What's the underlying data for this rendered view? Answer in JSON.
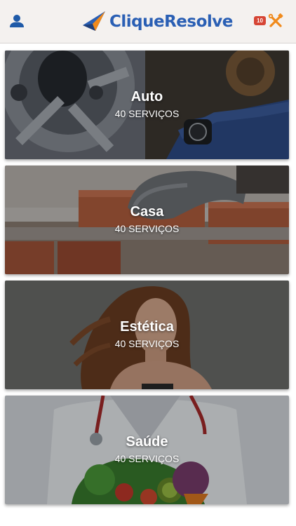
{
  "header": {
    "brand_name": "CliqueResolve",
    "notification_count": "10",
    "icons": {
      "user": "user-icon",
      "logo": "paper-plane-logo",
      "tools": "wrench-screwdriver-icon"
    },
    "colors": {
      "brand_blue": "#2a5fb4",
      "brand_dark": "#1e3f7a",
      "accent_orange": "#f08a1c",
      "badge_red": "#d64535",
      "header_bg": "#f4f1ef"
    }
  },
  "categories": [
    {
      "title": "Auto",
      "count": "40 SERVIÇOS"
    },
    {
      "title": "Casa",
      "count": "40 SERVIÇOS"
    },
    {
      "title": "Estética",
      "count": "40 SERVIÇOS"
    },
    {
      "title": "Saúde",
      "count": "40 SERVIÇOS"
    }
  ]
}
